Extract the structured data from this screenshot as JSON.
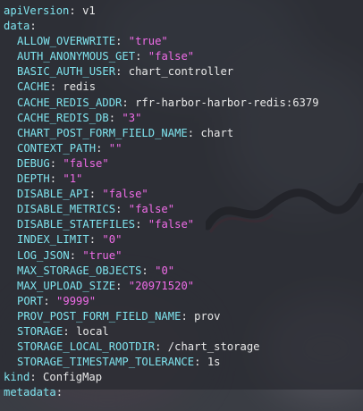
{
  "api_version": {
    "key": "apiVersion",
    "value": "v1"
  },
  "data_section": {
    "key": "data",
    "entries": [
      {
        "key": "ALLOW_OVERWRITE",
        "value": "\"true\"",
        "type": "string"
      },
      {
        "key": "AUTH_ANONYMOUS_GET",
        "value": "\"false\"",
        "type": "string"
      },
      {
        "key": "BASIC_AUTH_USER",
        "value": "chart_controller",
        "type": "plain"
      },
      {
        "key": "CACHE",
        "value": "redis",
        "type": "plain"
      },
      {
        "key": "CACHE_REDIS_ADDR",
        "value": "rfr-harbor-harbor-redis:6379",
        "type": "plain"
      },
      {
        "key": "CACHE_REDIS_DB",
        "value": "\"3\"",
        "type": "string"
      },
      {
        "key": "CHART_POST_FORM_FIELD_NAME",
        "value": "chart",
        "type": "plain"
      },
      {
        "key": "CONTEXT_PATH",
        "value": "\"\"",
        "type": "string"
      },
      {
        "key": "DEBUG",
        "value": "\"false\"",
        "type": "string"
      },
      {
        "key": "DEPTH",
        "value": "\"1\"",
        "type": "string"
      },
      {
        "key": "DISABLE_API",
        "value": "\"false\"",
        "type": "string"
      },
      {
        "key": "DISABLE_METRICS",
        "value": "\"false\"",
        "type": "string"
      },
      {
        "key": "DISABLE_STATEFILES",
        "value": "\"false\"",
        "type": "string"
      },
      {
        "key": "INDEX_LIMIT",
        "value": "\"0\"",
        "type": "string"
      },
      {
        "key": "LOG_JSON",
        "value": "\"true\"",
        "type": "string"
      },
      {
        "key": "MAX_STORAGE_OBJECTS",
        "value": "\"0\"",
        "type": "string"
      },
      {
        "key": "MAX_UPLOAD_SIZE",
        "value": "\"20971520\"",
        "type": "string"
      },
      {
        "key": "PORT",
        "value": "\"9999\"",
        "type": "string"
      },
      {
        "key": "PROV_POST_FORM_FIELD_NAME",
        "value": "prov",
        "type": "plain"
      },
      {
        "key": "STORAGE",
        "value": "local",
        "type": "plain"
      },
      {
        "key": "STORAGE_LOCAL_ROOTDIR",
        "value": "/chart_storage",
        "type": "plain"
      },
      {
        "key": "STORAGE_TIMESTAMP_TOLERANCE",
        "value": "1s",
        "type": "plain"
      }
    ]
  },
  "kind": {
    "key": "kind",
    "value": "ConfigMap"
  },
  "metadata": {
    "key": "metadata"
  },
  "colors": {
    "key": "#7fe3ee",
    "string_value": "#f06ce8",
    "plain_value": "#e8e8e8"
  }
}
